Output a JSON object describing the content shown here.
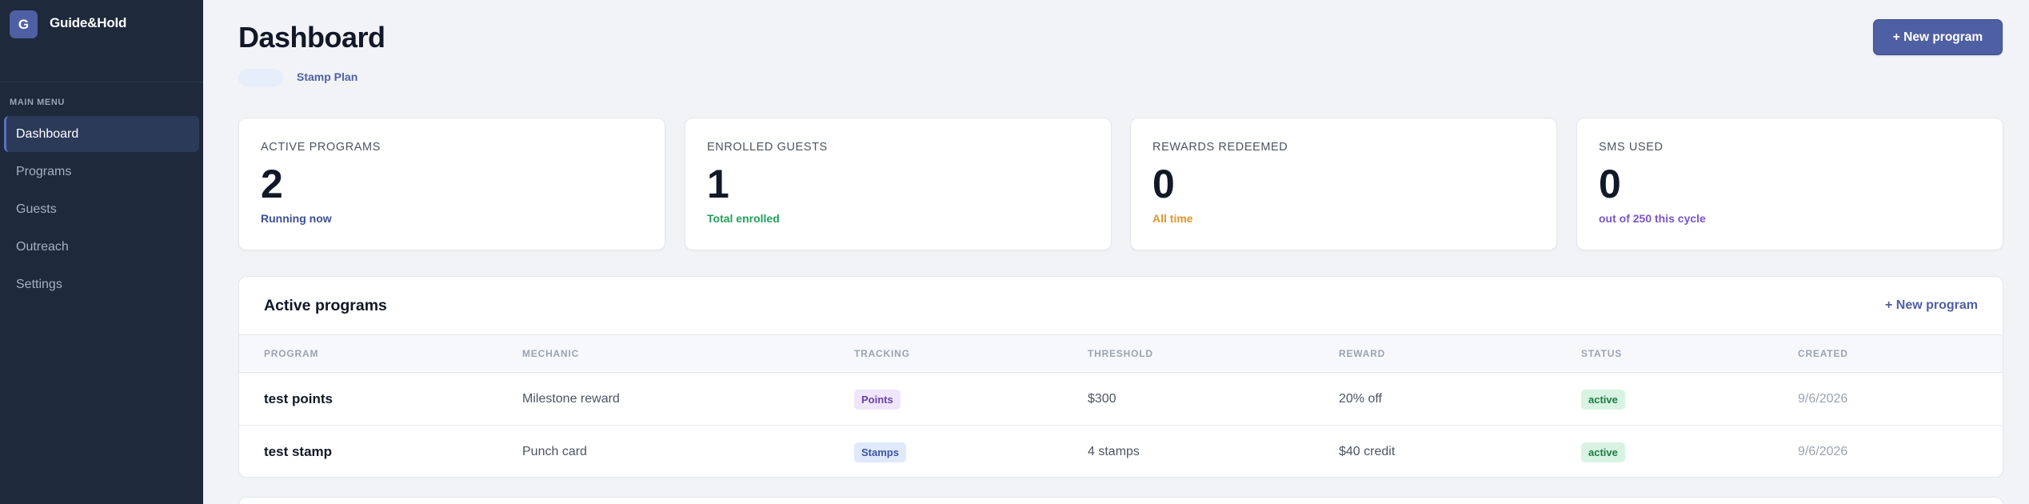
{
  "brand": {
    "logo_letter": "G",
    "name": "Guide&Hold"
  },
  "sidebar": {
    "heading": "MAIN MENU",
    "items": [
      {
        "label": "Dashboard",
        "active": true
      },
      {
        "label": "Programs"
      },
      {
        "label": "Guests"
      },
      {
        "label": "Outreach"
      },
      {
        "label": "Settings"
      }
    ]
  },
  "header": {
    "title": "Dashboard",
    "plan": "Stamp Plan",
    "new_program_label": "+ New program"
  },
  "stats": [
    {
      "label": "ACTIVE PROGRAMS",
      "value": "2",
      "sub": "Running now",
      "sub_color": "#3f4f95"
    },
    {
      "label": "ENROLLED GUESTS",
      "value": "1",
      "sub": "Total enrolled",
      "sub_color": "#22a05a"
    },
    {
      "label": "REWARDS REDEEMED",
      "value": "0",
      "sub": "All time",
      "sub_color": "#e0962d"
    },
    {
      "label": "SMS USED",
      "value": "0",
      "sub": "out of 250 this cycle",
      "sub_color": "#7a55c9"
    }
  ],
  "programs": {
    "title": "Active programs",
    "new_link": "+ New program",
    "columns": [
      "PROGRAM",
      "MECHANIC",
      "TRACKING",
      "THRESHOLD",
      "REWARD",
      "STATUS",
      "CREATED"
    ],
    "rows": [
      {
        "program": "test points",
        "mechanic": "Milestone reward",
        "tracking": "Points",
        "threshold": "$300",
        "reward": "20% off",
        "status": "active",
        "created": "9/6/2026"
      },
      {
        "program": "test stamp",
        "mechanic": "Punch card",
        "tracking": "Stamps",
        "threshold": "4 stamps",
        "reward": "$40 credit",
        "status": "active",
        "created": "9/6/2026"
      }
    ]
  }
}
